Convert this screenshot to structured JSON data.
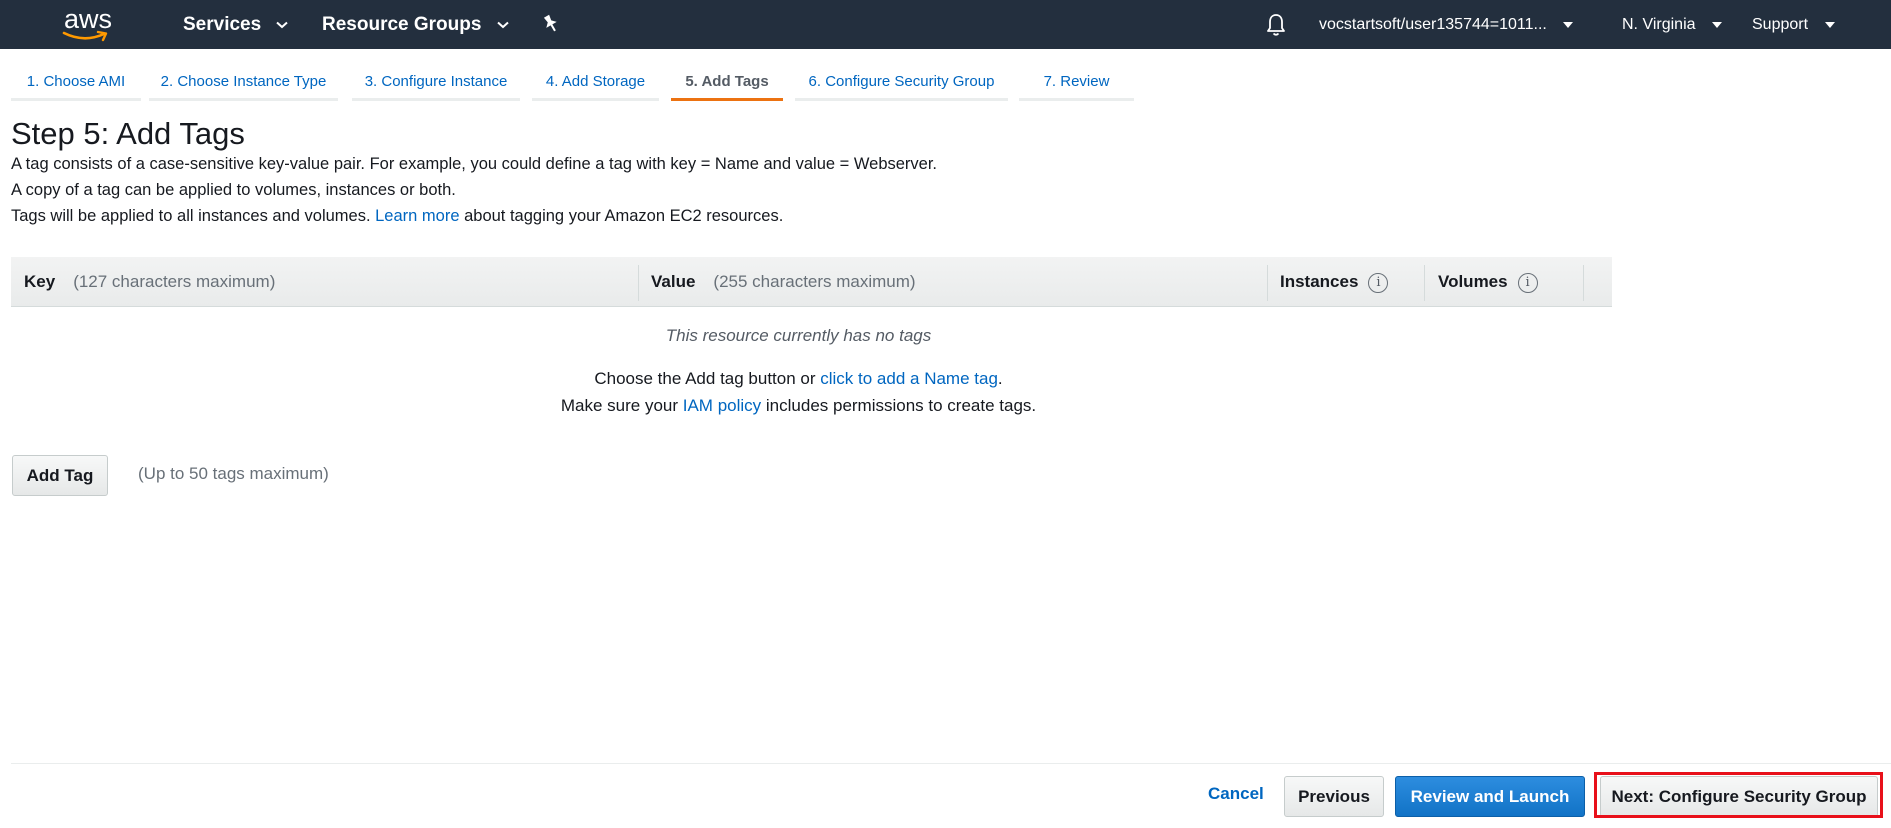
{
  "topbar": {
    "logo_text": "aws",
    "services": "Services",
    "resource_groups": "Resource Groups",
    "account": "vocstartsoft/user135744=1011...",
    "region": "N. Virginia",
    "support": "Support"
  },
  "wizard": {
    "tabs": [
      {
        "label": "1. Choose AMI"
      },
      {
        "label": "2. Choose Instance Type"
      },
      {
        "label": "3. Configure Instance"
      },
      {
        "label": "4. Add Storage"
      },
      {
        "label": "5. Add Tags"
      },
      {
        "label": "6. Configure Security Group"
      },
      {
        "label": "7. Review"
      }
    ],
    "active_tab": "5. Add Tags"
  },
  "page": {
    "title": "Step 5: Add Tags",
    "intro_line1": "A tag consists of a case-sensitive key-value pair. For example, you could define a tag with key = Name and value = Webserver.",
    "intro_line2": "A copy of a tag can be applied to volumes, instances or both.",
    "intro_line3_pre": "Tags will be applied to all instances and volumes. ",
    "intro_line3_link": "Learn more",
    "intro_line3_post": " about tagging your Amazon EC2 resources."
  },
  "table": {
    "key_header": "Key",
    "key_hint": "(127 characters maximum)",
    "value_header": "Value",
    "value_hint": "(255 characters maximum)",
    "instances_header": "Instances",
    "volumes_header": "Volumes",
    "info_glyph": "i",
    "empty_message": "This resource currently has no tags",
    "help1_pre": "Choose the Add tag button or ",
    "help1_link": "click to add a Name tag",
    "help1_post": ".",
    "help2_pre": "Make sure your ",
    "help2_link": "IAM policy",
    "help2_post": " includes permissions to create tags."
  },
  "actions": {
    "add_tag": "Add Tag",
    "add_tag_note": "(Up to 50 tags maximum)",
    "cancel": "Cancel",
    "previous": "Previous",
    "review_launch": "Review and Launch",
    "next": "Next: Configure Security Group"
  },
  "colors": {
    "nav_bg": "#232f3e",
    "link": "#0066c0",
    "active_tab_underline": "#ec7211",
    "primary_button": "#1173c6",
    "highlight_box": "#e8101a"
  }
}
